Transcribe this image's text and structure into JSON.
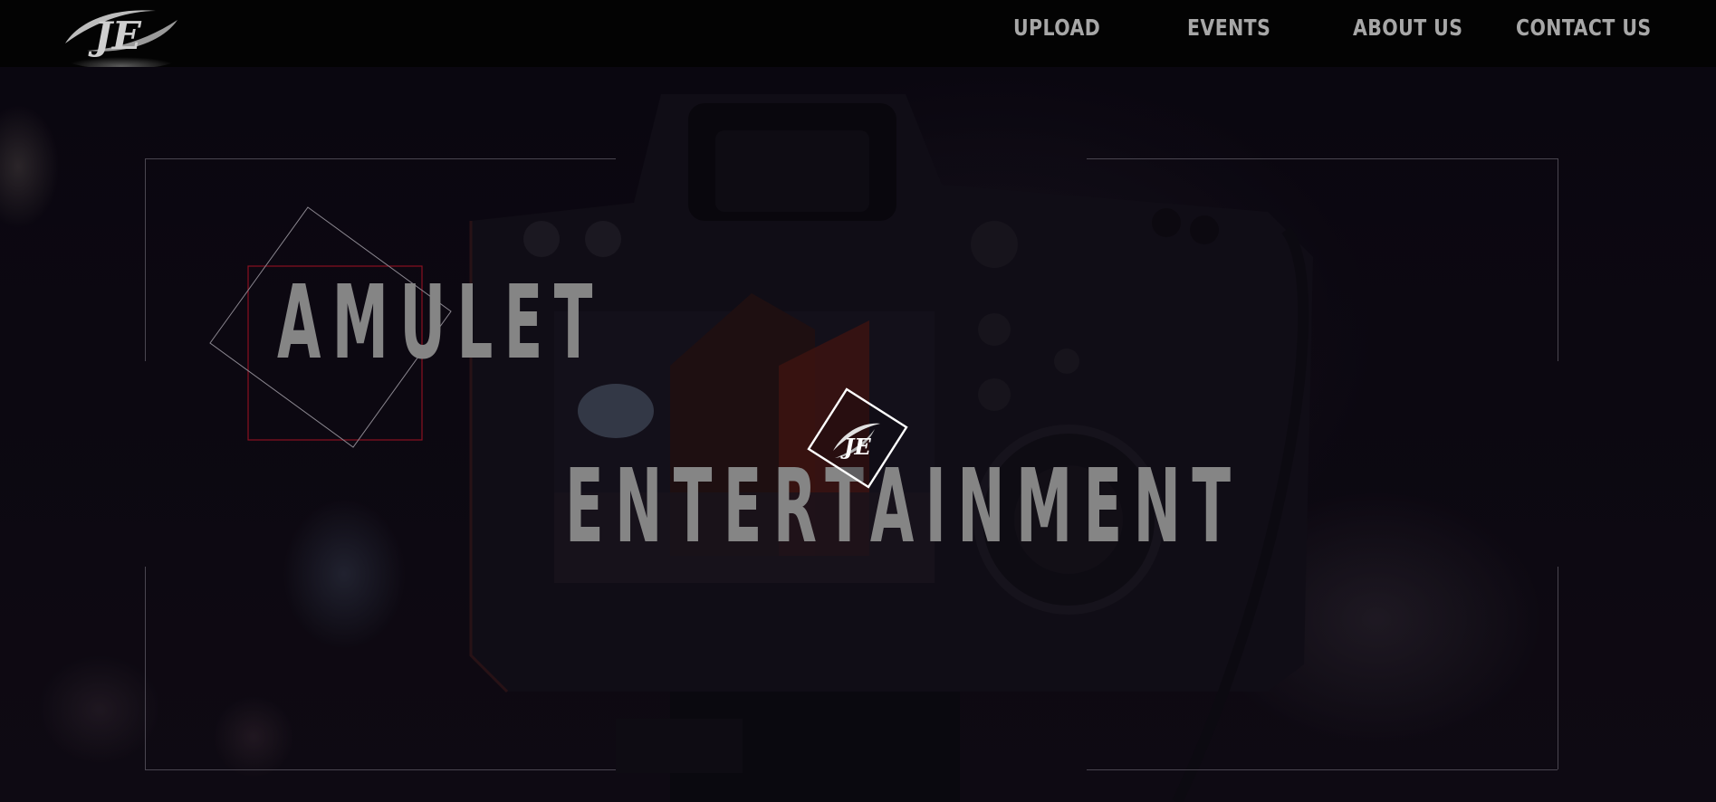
{
  "nav": {
    "items": [
      {
        "label": "UPLOAD"
      },
      {
        "label": "EVENTS"
      },
      {
        "label": "ABOUT US"
      },
      {
        "label": "CONTACT US"
      }
    ]
  },
  "hero": {
    "title_line1": "AMULET",
    "title_line2": "ENTERTAINMENT",
    "background": "camera-photo",
    "accent_square_color": "#8a1020"
  },
  "icons": {
    "logo": "ae-logo-icon",
    "center_badge": "ae-logo-badge-icon"
  },
  "colors": {
    "navbar": "#030303",
    "nav_text": "#a7a7a7",
    "title_text": "#858585",
    "frame_lines": "#4a4650"
  }
}
